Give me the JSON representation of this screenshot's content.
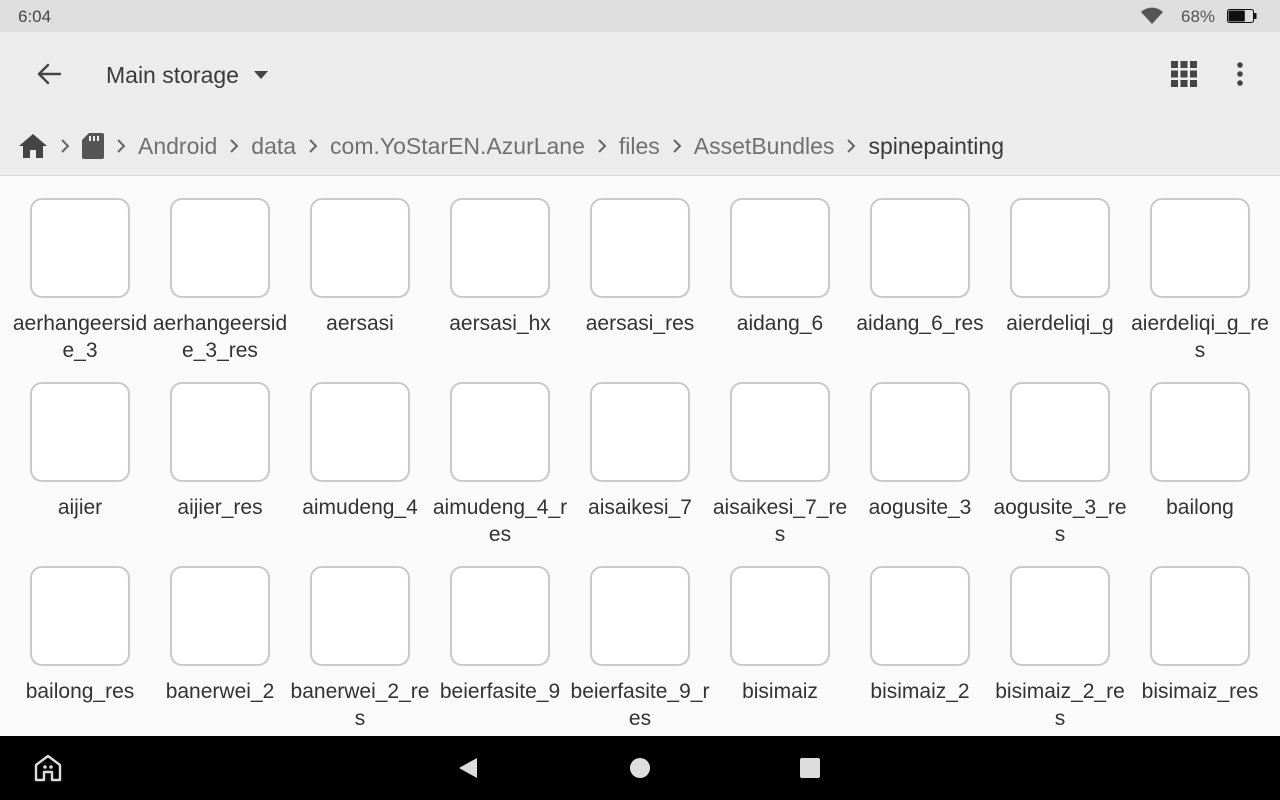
{
  "status_bar": {
    "time": "6:04",
    "battery_percent": "68%",
    "battery_level": 0.68,
    "icons": [
      "wifi-icon",
      "battery-icon"
    ]
  },
  "app_bar": {
    "title": "Main storage",
    "icons": [
      "arrow-back-icon",
      "caret-down-icon",
      "grid-view-icon",
      "more-vert-icon"
    ]
  },
  "breadcrumb": {
    "icons": [
      "home-icon",
      "sd-card-icon",
      "chevron-right-icon"
    ],
    "items": [
      "Android",
      "data",
      "com.YoStarEN.AzurLane",
      "files",
      "AssetBundles",
      "spinepainting"
    ]
  },
  "files": [
    "aerhangeerside_3",
    "aerhangeerside_3_res",
    "aersasi",
    "aersasi_hx",
    "aersasi_res",
    "aidang_6",
    "aidang_6_res",
    "aierdeliqi_g",
    "aierdeliqi_g_res",
    "aijier",
    "aijier_res",
    "aimudeng_4",
    "aimudeng_4_res",
    "aisaikesi_7",
    "aisaikesi_7_res",
    "aogusite_3",
    "aogusite_3_res",
    "bailong",
    "bailong_res",
    "banerwei_2",
    "banerwei_2_res",
    "beierfasite_9",
    "beierfasite_9_res",
    "bisimaiz",
    "bisimaiz_2",
    "bisimaiz_2_res",
    "bisimaiz_res"
  ],
  "nav_bar": {
    "icons": [
      "assistant-home-icon",
      "back-triangle-icon",
      "home-circle-icon",
      "recents-square-icon"
    ]
  }
}
